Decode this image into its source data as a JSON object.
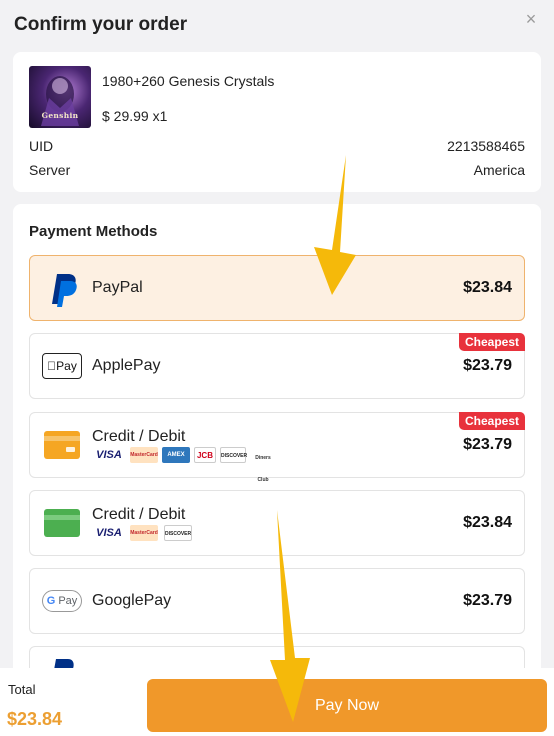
{
  "header": {
    "title": "Confirm your order",
    "close_glyph": "×"
  },
  "order": {
    "product_name": "1980+260 Genesis Crystals",
    "price_qty": "$ 29.99 x1",
    "thumb_logo": "Genshin",
    "uid_label": "UID",
    "uid_value": "2213588465",
    "server_label": "Server",
    "server_value": "America"
  },
  "payment": {
    "title": "Payment Methods",
    "methods": [
      {
        "name": "PayPal",
        "price": "$23.84",
        "badge": "",
        "icon": "paypal-icon",
        "selected": true
      },
      {
        "name": "ApplePay",
        "price": "$23.79",
        "badge": "Cheapest",
        "icon": "applepay-icon",
        "selected": false
      },
      {
        "name": "Credit / Debit",
        "price": "$23.79",
        "badge": "Cheapest",
        "icon": "orange-card-icon",
        "selected": false,
        "brands": [
          "VISA",
          "MasterCard",
          "AMEX",
          "JCB",
          "DISCOVER",
          "Diners Club"
        ]
      },
      {
        "name": "Credit / Debit",
        "price": "$23.84",
        "badge": "",
        "icon": "green-card-icon",
        "selected": false,
        "brands": [
          "VISA",
          "MasterCard",
          "DISCOVER"
        ]
      },
      {
        "name": "GooglePay",
        "price": "$23.79",
        "badge": "",
        "icon": "googlepay-icon",
        "selected": false
      }
    ]
  },
  "footer": {
    "total_label": "Total",
    "total_value": "$23.84",
    "pay_button": "Pay Now"
  },
  "colors": {
    "accent": "#f0982a",
    "total": "#ec9f32",
    "badge": "#e8323c",
    "selected_bg": "#fdf0e2",
    "arrow": "#f5b90a"
  }
}
